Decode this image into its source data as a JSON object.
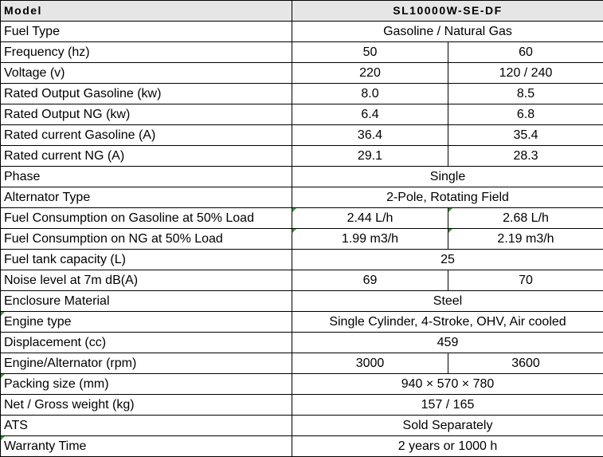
{
  "header": {
    "label": "Model",
    "value": "SL10000W-SE-DF"
  },
  "rows": [
    {
      "label": "Fuel Type",
      "value": "Gasoline / Natural Gas"
    },
    {
      "label": "Frequency  (hz)",
      "v50": "50",
      "v60": "60"
    },
    {
      "label": "Voltage (v)",
      "v50": "220",
      "v60": "120 / 240"
    },
    {
      "label": "Rated Output Gasoline (kw)",
      "v50": "8.0",
      "v60": "8.5"
    },
    {
      "label": "Rated Output NG (kw)",
      "v50": "6.4",
      "v60": "6.8"
    },
    {
      "label": "Rated current  Gasoline (A)",
      "v50": "36.4",
      "v60": "35.4"
    },
    {
      "label": "Rated current NG (A)",
      "v50": "29.1",
      "v60": "28.3"
    },
    {
      "label": "Phase",
      "value": "Single"
    },
    {
      "label": "Alternator Type",
      "value": "2-Pole, Rotating Field"
    },
    {
      "label": "Fuel Consumption on Gasoline at 50% Load",
      "v50": "2.44 L/h",
      "v60": "2.68 L/h"
    },
    {
      "label": "Fuel Consumption on NG at 50% Load",
      "v50": "1.99 m3/h",
      "v60": "2.19 m3/h"
    },
    {
      "label": "Fuel tank capacity (L)",
      "value": "25"
    },
    {
      "label": "Noise level at 7m  dB(A)",
      "v50": "69",
      "v60": "70"
    },
    {
      "label": "Enclosure Material",
      "value": "Steel"
    },
    {
      "label": "Engine type",
      "value": "Single Cylinder, 4-Stroke, OHV, Air cooled"
    },
    {
      "label": "Displacement (cc)",
      "value": "459"
    },
    {
      "label": "Engine/Alternator (rpm)",
      "v50": "3000",
      "v60": "3600"
    },
    {
      "label": "Packing size (mm)",
      "value": "940  × 570 × 780"
    },
    {
      "label": "Net / Gross weight (kg)",
      "value": "157 / 165"
    },
    {
      "label": "ATS",
      "value": "Sold Separately"
    },
    {
      "label": "Warranty Time",
      "value": "2 years or 1000 h"
    }
  ],
  "colors": {
    "header_bg": "#e6e6e6",
    "border": "#000000",
    "cell_marker": "#3a9a3a"
  }
}
